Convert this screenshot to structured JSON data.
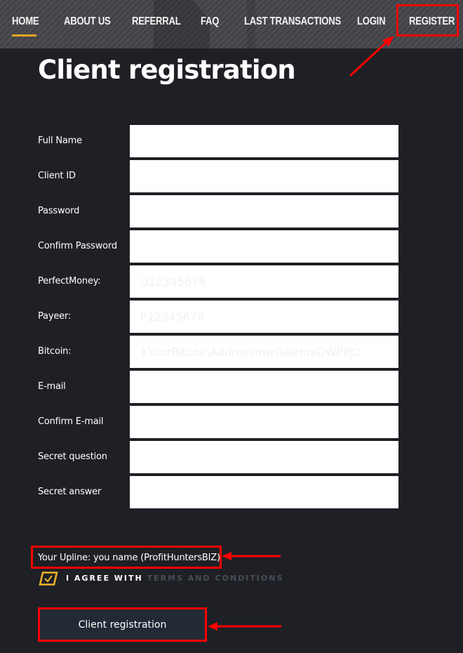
{
  "nav": {
    "items": [
      {
        "label": "Home",
        "active": true
      },
      {
        "label": "About us",
        "active": false
      },
      {
        "label": "Referral",
        "active": false
      },
      {
        "label": "FAQ",
        "active": false
      },
      {
        "label": "Last transactions",
        "active": false
      },
      {
        "label": "Login",
        "active": false
      },
      {
        "label": "Register",
        "active": false
      }
    ],
    "accent_color": "#e8a51e"
  },
  "page": {
    "title": "Client registration"
  },
  "form": {
    "fields": [
      {
        "label": "Full Name",
        "value": "",
        "placeholder": ""
      },
      {
        "label": "Client ID",
        "value": "",
        "placeholder": ""
      },
      {
        "label": "Password",
        "value": "",
        "placeholder": ""
      },
      {
        "label": "Confirm Password",
        "value": "",
        "placeholder": ""
      },
      {
        "label": "PerfectMoney:",
        "value": "",
        "placeholder": "U12345678"
      },
      {
        "label": "Payeer:",
        "value": "",
        "placeholder": "P12345678"
      },
      {
        "label": "Bitcoin:",
        "value": "",
        "placeholder": "1YourBitcoinAddressmwGAiHnxQWP8J2"
      },
      {
        "label": "E-mail",
        "value": "",
        "placeholder": ""
      },
      {
        "label": "Confirm E-mail",
        "value": "",
        "placeholder": ""
      },
      {
        "label": "Secret question",
        "value": "",
        "placeholder": ""
      },
      {
        "label": "Secret answer",
        "value": "",
        "placeholder": ""
      }
    ],
    "upline_text": "Your Upline: you name (ProfitHuntersBIZ)",
    "agree": {
      "checked": true,
      "prefix": "I AGREE WITH",
      "link_text": "TERMS AND CONDITIONS"
    },
    "submit_label": "Client registration"
  },
  "annotations": {
    "highlight_color": "#ff0000"
  }
}
